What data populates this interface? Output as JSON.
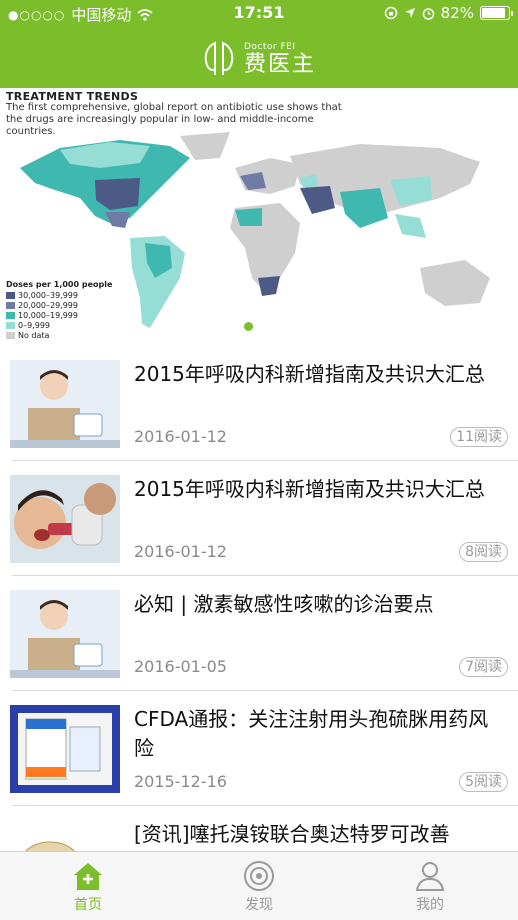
{
  "status_bar": {
    "carrier": "中国移动",
    "time": "17:51",
    "battery": "82%"
  },
  "header": {
    "brand_en": "Doctor FEI",
    "brand_cn": "费医主"
  },
  "banner": {
    "title": "TREATMENT TRENDS",
    "subtitle": "The first comprehensive, global report on antibiotic use shows that the drugs are increasingly popular in low- and middle-income countries.",
    "legend_title": "Doses per 1,000 people",
    "legend": [
      {
        "label": "30,000–39,999",
        "color": "#4d5a86"
      },
      {
        "label": "20,000–29,999",
        "color": "#6f7ba4"
      },
      {
        "label": "10,000–19,999",
        "color": "#3fb8b0"
      },
      {
        "label": "0–9,999",
        "color": "#96ddd5"
      },
      {
        "label": "No data",
        "color": "#cfcfcf"
      }
    ]
  },
  "articles": [
    {
      "title": "2015年呼吸内科新增指南及共识大汇总",
      "date": "2016-01-12",
      "reads": "11阅读"
    },
    {
      "title": "2015年呼吸内科新增指南及共识大汇总",
      "date": "2016-01-12",
      "reads": "8阅读"
    },
    {
      "title": "必知 | 激素敏感性咳嗽的诊治要点",
      "date": "2016-01-05",
      "reads": "7阅读"
    },
    {
      "title": "CFDA通报：关注注射用头孢硫脒用药风险",
      "date": "2015-12-16",
      "reads": "5阅读"
    },
    {
      "title": "[资讯]噻托溴铵联合奥达特罗可改善"
    }
  ],
  "tabs": {
    "home": "首页",
    "discover": "发现",
    "mine": "我的"
  },
  "colors": {
    "brand_green": "#7cbd2c"
  }
}
